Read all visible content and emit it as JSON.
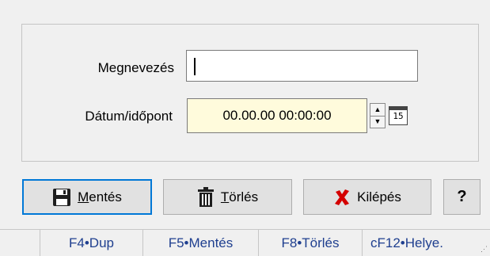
{
  "form": {
    "name_label": "Megnevezés",
    "name_value": "",
    "date_label": "Dátum/időpont",
    "date_value": "00.00.00 00:00:00",
    "calendar_day": "15"
  },
  "buttons": {
    "save": {
      "accel": "M",
      "rest": "entés"
    },
    "delete": {
      "accel": "T",
      "rest": "örlés"
    },
    "exit": "Kilépés",
    "help": "?"
  },
  "statusbar": {
    "f4": "F4•Dup",
    "f5": "F5•Mentés",
    "f8": "F8•Törlés",
    "f12": "cF12•Helye."
  },
  "colors": {
    "date_background": "#fffbdc",
    "statusbar_text": "#1f3f8f",
    "primary_border": "#0078d7",
    "exit_icon": "#d40000"
  },
  "icons": {
    "save": "floppy-disk-icon",
    "delete": "trash-icon",
    "exit": "red-x-icon",
    "spinner": "spinner-icon",
    "calendar": "calendar-icon"
  }
}
